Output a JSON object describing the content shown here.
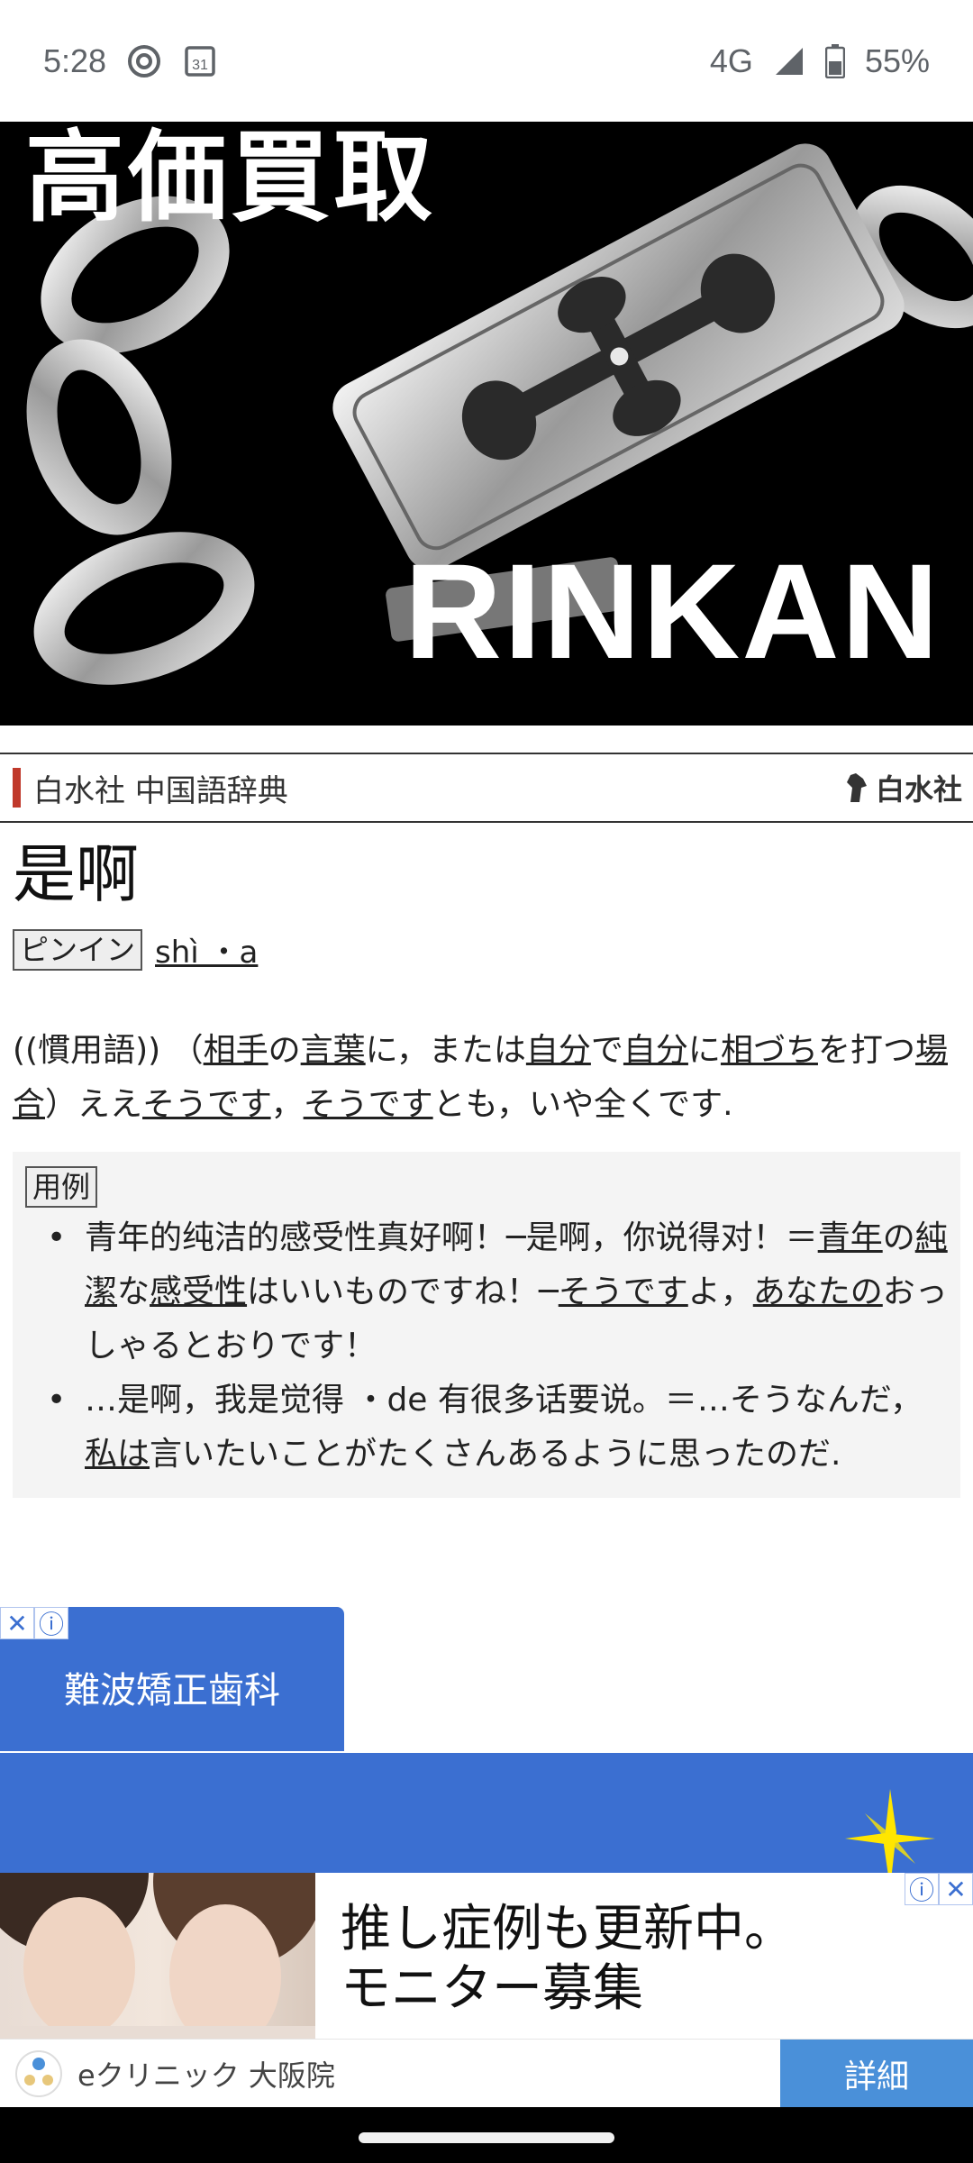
{
  "status_bar": {
    "time": "5:28",
    "left_icons": [
      "at-sign-icon",
      "calendar-icon"
    ],
    "calendar_day": "31",
    "network": "4G",
    "battery": "55%"
  },
  "top_ad": {
    "jp_text": "高価買取",
    "brand": "RINKAN"
  },
  "dictionary": {
    "source": "白水社 中国語辞典",
    "publisher_logo": "白水社"
  },
  "entry": {
    "headword": "是啊",
    "pinyin_tag": "ピンイン",
    "pinyin": "shì ・a",
    "definition": {
      "p1": "((慣用語)) （",
      "l1": "相手",
      "p2": "の",
      "l2": "言葉",
      "p3": "に，または",
      "l3": "自分",
      "p4": "で",
      "l4": "自分",
      "p5": "に",
      "l5": "相づち",
      "p6": "を打つ",
      "l6": "場合",
      "p7": "）ええ",
      "l7": "そうです",
      "p8": "，",
      "l8": "そうです",
      "p9": "とも，いや全くです."
    },
    "examples_tag": "用例",
    "example1": {
      "p1": "青年的纯洁的感受性真好啊！─是啊，你说得对！＝",
      "l1": "青年",
      "p2": "の",
      "l2": "純潔",
      "p3": "な",
      "l3": "感受性",
      "p4": "はいいものですね！─",
      "l4": "そうです",
      "p5": "よ，",
      "l5": "あなたの",
      "p6": "おっしゃるとおりです！"
    },
    "example2": {
      "p1": "…是啊，我是觉得 ・de 有很多话要说。＝…そうなんだ，",
      "l1": "私は",
      "p2": "言いたいことがたくさんあるように思ったのだ."
    }
  },
  "bottom_ad": {
    "tab_label": "難波矯正歯科",
    "headline_line1": "推し症例も更新中。",
    "headline_line2": "モニター募集",
    "advertiser": "eクリニック 大阪院",
    "cta": "詳細",
    "close_symbol": "✕",
    "info_symbol": "ⓘ"
  },
  "colors": {
    "accent_bar": "#c0392b",
    "ad_blue": "#3b6fd1",
    "cta_blue": "#4a90d9"
  }
}
